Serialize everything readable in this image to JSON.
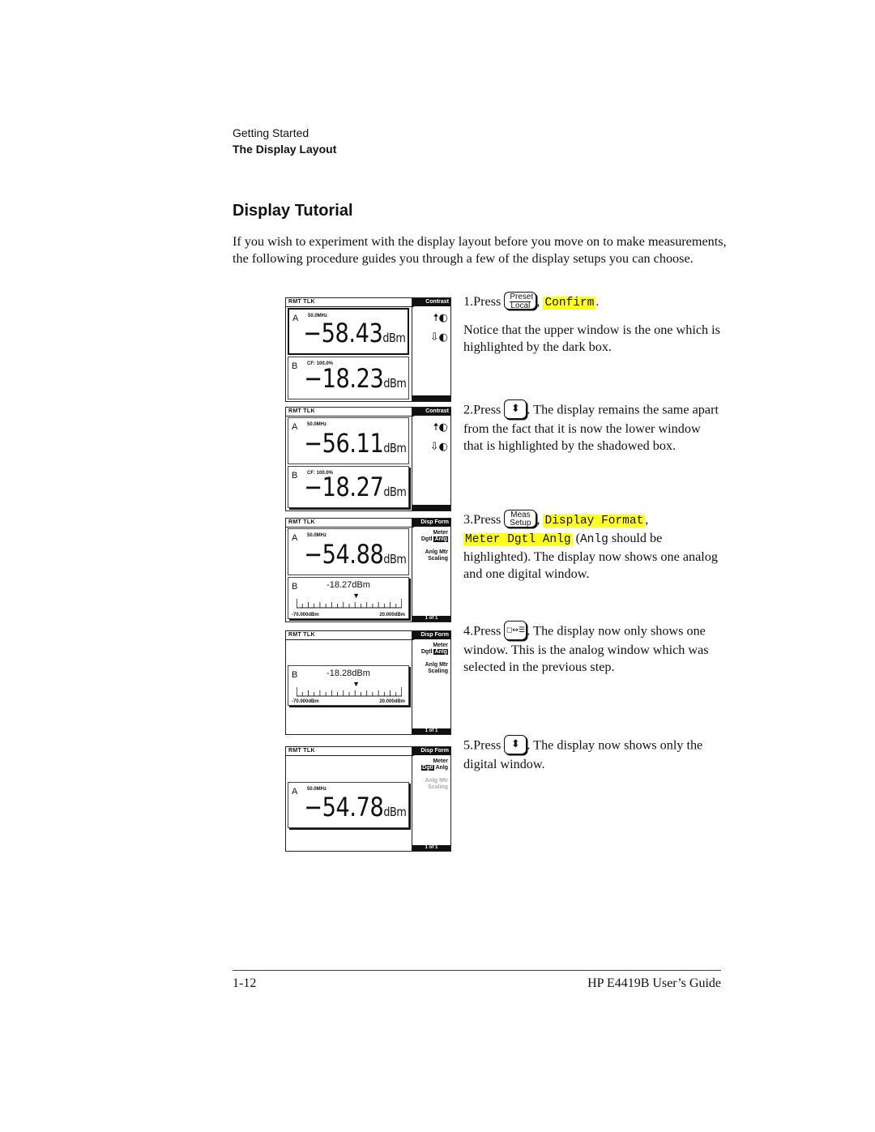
{
  "header": {
    "section": "Getting Started",
    "subsection": "The Display Layout"
  },
  "title": "Display Tutorial",
  "intro": "If you wish to experiment with the display layout before you move on to make measurements, the following procedure guides you through a few of the display setups you can choose.",
  "steps": [
    {
      "num": "1.Press",
      "key": {
        "top": "Preset",
        "bottom": "Local"
      },
      "sep": ",",
      "softkey": "Confirm",
      "end": ".",
      "text": "Notice that the upper window is the one which is highlighted by the dark box."
    },
    {
      "num": "2.Press",
      "key_icon": "up-down-arrow",
      "key_glyph": "⬍",
      "text": ". The display remains the same apart from the fact that it is now the lower window that is highlighted by the shadowed box."
    },
    {
      "num": "3.Press",
      "key": {
        "top": "Meas",
        "bottom": "Setup"
      },
      "sep": ",",
      "softkey1": "Display Format",
      "sep2": ",",
      "softkey2": "Meter Dgtl Anlg",
      "paren_open": " (",
      "code": "Anlg",
      "text": " should be highlighted). The display now shows one analog and one digital window."
    },
    {
      "num": "4.Press",
      "key_icon": "window-toggle",
      "key_glyph": "◻↔☰",
      "text": ". The display now only shows one window. This is the analog window which was selected in the previous step."
    },
    {
      "num": "5.Press",
      "key_icon": "up-down-arrow",
      "key_glyph": "⬍",
      "text": ". The display now shows only the digital window."
    }
  ],
  "screens": [
    {
      "status": "RMT TLK",
      "menu_title": "Contrast",
      "contrast_up": "🠅◐",
      "contrast_down": "⇩◐",
      "win_a": {
        "channel": "A",
        "sub": "50.0MHz",
        "value": "−58.43",
        "unit": "dBm"
      },
      "win_b": {
        "channel": "B",
        "sub": "CF: 100.0%",
        "value": "−18.23",
        "unit": "dBm"
      }
    },
    {
      "status": "RMT TLK",
      "menu_title": "Contrast",
      "contrast_up": "🠅◐",
      "contrast_down": "⇩◐",
      "win_a": {
        "channel": "A",
        "sub": "50.0MHz",
        "value": "−56.11",
        "unit": "dBm"
      },
      "win_b": {
        "channel": "B",
        "sub": "CF: 100.0%",
        "value": "−18.27",
        "unit": "dBm"
      }
    },
    {
      "status": "RMT TLK",
      "menu_title": "Disp Form",
      "menu_meter": "Meter",
      "menu_dgtl": "Dgtl",
      "menu_anlg": "Anlg",
      "menu_scaling1": "Anlg Mtr",
      "menu_scaling2": "Scaling",
      "page": "1 of 1",
      "win_a": {
        "channel": "A",
        "sub": "50.0MHz",
        "value": "−54.88",
        "unit": "dBm"
      },
      "win_b": {
        "channel": "B",
        "value": "-18.27dBm",
        "lo": "-70.000dBm",
        "hi": "20.000dBm",
        "needle_fraction": 0.58
      }
    },
    {
      "status": "RMT TLK",
      "menu_title": "Disp Form",
      "menu_meter": "Meter",
      "menu_dgtl": "Dgtl",
      "menu_anlg": "Anlg",
      "menu_scaling1": "Anlg Mtr",
      "menu_scaling2": "Scaling",
      "page": "1 of 1",
      "win_b": {
        "channel": "B",
        "value": "-18.28dBm",
        "lo": "-70.000dBm",
        "hi": "20.000dBm",
        "needle_fraction": 0.58
      }
    },
    {
      "status": "RMT TLK",
      "menu_title": "Disp Form",
      "menu_meter": "Meter",
      "menu_dgtl": "Dgtl",
      "menu_anlg": "Anlg",
      "menu_scaling1": "Anlg Mtr",
      "menu_scaling2": "Scaling",
      "page": "1 of 1",
      "win_a": {
        "channel": "A",
        "sub": "50.0MHz",
        "value": "−54.78",
        "unit": "dBm"
      }
    }
  ],
  "footer": {
    "page": "1-12",
    "title": "HP E4419B User’s Guide"
  }
}
